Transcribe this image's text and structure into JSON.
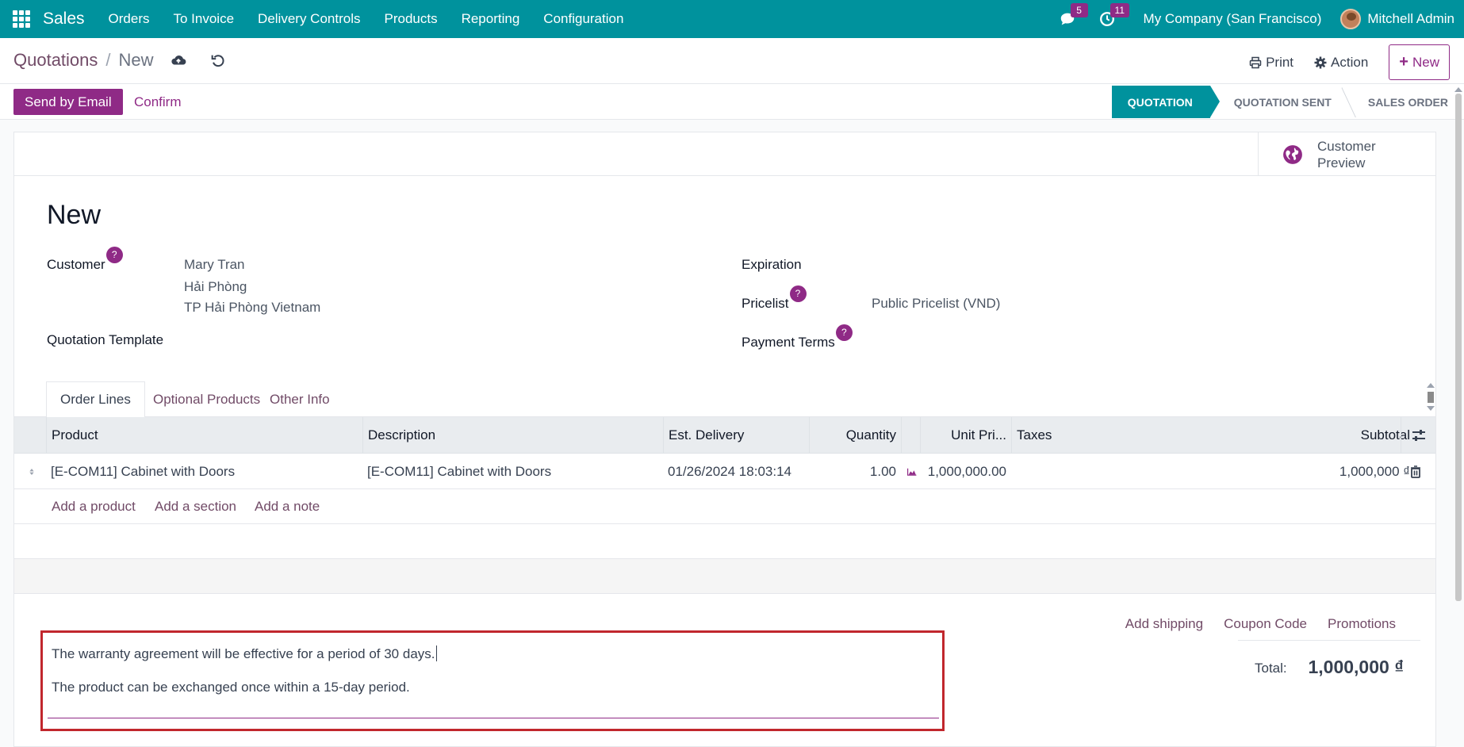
{
  "navbar": {
    "app_name": "Sales",
    "menu": [
      "Orders",
      "To Invoice",
      "Delivery Controls",
      "Products",
      "Reporting",
      "Configuration"
    ],
    "messages_count": "5",
    "activities_count": "11",
    "company": "My Company (San Francisco)",
    "user": "Mitchell Admin"
  },
  "breadcrumb": {
    "parent": "Quotations",
    "separator": "/",
    "current": "New"
  },
  "control_panel": {
    "print_label": "Print",
    "action_label": "Action",
    "new_label": "New"
  },
  "statusbar": {
    "send_email_label": "Send by Email",
    "confirm_label": "Confirm",
    "stages": [
      "QUOTATION",
      "QUOTATION SENT",
      "SALES ORDER"
    ],
    "active_stage": "QUOTATION"
  },
  "button_box": {
    "customer_preview": "Customer Preview"
  },
  "form": {
    "title": "New",
    "customer_label": "Customer",
    "customer_name": "Mary Tran",
    "customer_address_line1": "Hải Phòng",
    "customer_address_line2": "TP Hải Phòng Vietnam",
    "quotation_template_label": "Quotation Template",
    "expiration_label": "Expiration",
    "pricelist_label": "Pricelist",
    "pricelist_value": "Public Pricelist (VND)",
    "payment_terms_label": "Payment Terms",
    "help_mark": "?"
  },
  "tabs": [
    "Order Lines",
    "Optional Products",
    "Other Info"
  ],
  "order_table": {
    "columns": {
      "product": "Product",
      "description": "Description",
      "est_delivery": "Est. Delivery",
      "quantity": "Quantity",
      "unit_price": "Unit Pri...",
      "taxes": "Taxes",
      "subtotal": "Subtotal"
    },
    "rows": [
      {
        "product": "[E-COM11] Cabinet with Doors",
        "description": "[E-COM11] Cabinet with Doors",
        "est_delivery": "01/26/2024 18:03:14",
        "quantity": "1.00",
        "unit_price": "1,000,000.00",
        "taxes": "",
        "subtotal": "1,000,000 ₫"
      }
    ],
    "add_product": "Add a product",
    "add_section": "Add a section",
    "add_note": "Add a note"
  },
  "footer": {
    "note_line1": "The warranty agreement will be effective for a period of 30 days.",
    "note_line2": "The product can be exchanged once within a 15-day period.",
    "add_shipping": "Add shipping",
    "coupon_code": "Coupon Code",
    "promotions": "Promotions",
    "total_label": "Total:",
    "total_value": "1,000,000 ₫"
  },
  "colors": {
    "navbar": "#00929d",
    "brand_purple": "#8f2a86",
    "link_purple": "#714b67",
    "highlight_border": "#c1272d"
  },
  "icons": [
    "apps-grid-icon",
    "chat-icon",
    "clock-icon",
    "cloud-upload-icon",
    "undo-icon",
    "print-icon",
    "gear-icon",
    "plus-icon",
    "globe-icon",
    "drag-handle-icon",
    "area-chart-icon",
    "trash-icon",
    "column-settings-icon"
  ]
}
